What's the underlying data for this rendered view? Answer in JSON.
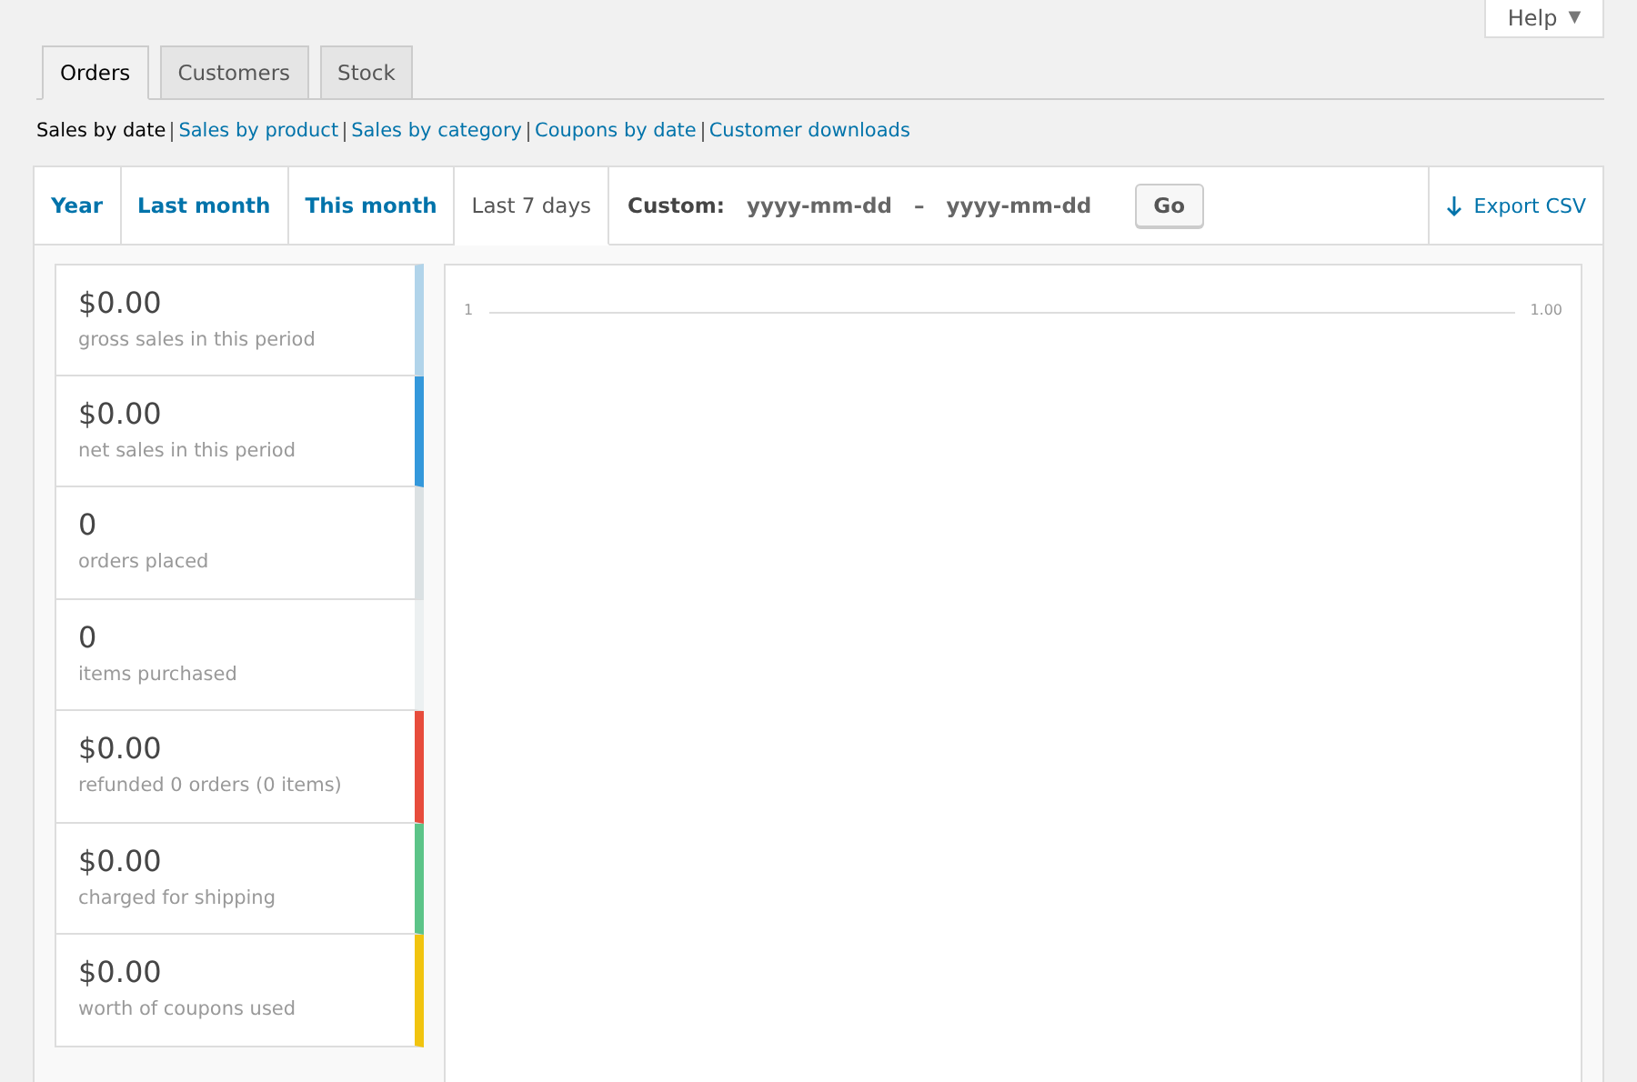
{
  "help": {
    "label": "Help",
    "caret": "▼"
  },
  "tabs": [
    {
      "label": "Orders",
      "selected": true
    },
    {
      "label": "Customers",
      "selected": false
    },
    {
      "label": "Stock",
      "selected": false
    }
  ],
  "subnav": [
    {
      "label": "Sales by date",
      "selected": true
    },
    {
      "label": "Sales by product",
      "selected": false
    },
    {
      "label": "Sales by category",
      "selected": false
    },
    {
      "label": "Coupons by date",
      "selected": false
    },
    {
      "label": "Customer downloads",
      "selected": false
    }
  ],
  "ranges": [
    {
      "label": "Year",
      "selected": false
    },
    {
      "label": "Last month",
      "selected": false
    },
    {
      "label": "This month",
      "selected": false
    },
    {
      "label": "Last 7 days",
      "selected": true
    }
  ],
  "custom": {
    "label": "Custom:",
    "start_placeholder": "yyyy-mm-dd",
    "separator": "–",
    "end_placeholder": "yyyy-mm-dd",
    "button": "Go"
  },
  "export": {
    "label": "Export CSV"
  },
  "legend": [
    {
      "value": "$0.00",
      "label": "gross sales in this period",
      "color": "#b1d4ea"
    },
    {
      "value": "$0.00",
      "label": "net sales in this period",
      "color": "#3498db"
    },
    {
      "value": "0",
      "label": "orders placed",
      "color": "#dbe1e3"
    },
    {
      "value": "0",
      "label": "items purchased",
      "color": "#ecf0f1"
    },
    {
      "value": "$0.00",
      "label": "refunded 0 orders (0 items)",
      "color": "#e74c3c"
    },
    {
      "value": "$0.00",
      "label": "charged for shipping",
      "color": "#5cc488"
    },
    {
      "value": "$0.00",
      "label": "worth of coupons used",
      "color": "#f1c40f"
    }
  ],
  "chart": {
    "left_axis_label": "1",
    "right_axis_label": "1.00"
  }
}
